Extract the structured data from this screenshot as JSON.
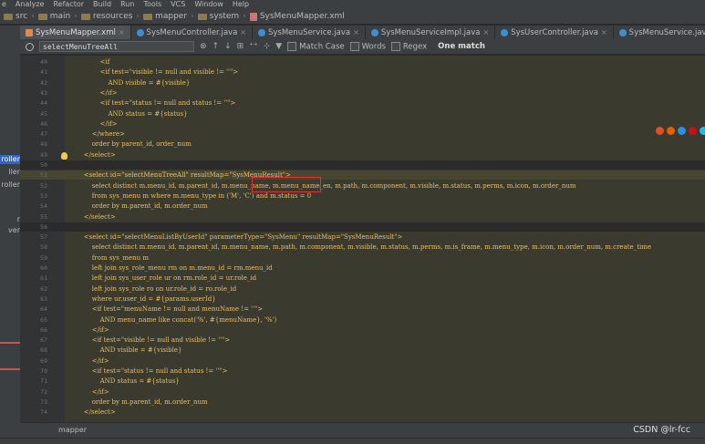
{
  "menubar": {
    "items": [
      "e",
      "Analyze",
      "Refactor",
      "Build",
      "Run",
      "Tools",
      "VCS",
      "Window",
      "Help"
    ]
  },
  "breadcrumbs": [
    "src",
    "main",
    "resources",
    "mapper",
    "system",
    "SysMenuMapper.xml"
  ],
  "tabs": [
    {
      "label": "SysMenuMapper.xml",
      "active": true,
      "icon": "xml-file-icon"
    },
    {
      "label": "SysMenuController.java",
      "active": false,
      "icon": "java-class-icon"
    },
    {
      "label": "SysMenuService.java",
      "active": false,
      "icon": "java-class-icon"
    },
    {
      "label": "SysMenuServiceImpl.java",
      "active": false,
      "icon": "java-class-icon"
    },
    {
      "label": "SysUserController.java",
      "active": false,
      "icon": "java-class-icon"
    },
    {
      "label": "SysMenuService.java",
      "active": false,
      "icon": "java-class-icon"
    }
  ],
  "sidebar": {
    "items": [
      "roller",
      "ller",
      "roller",
      "r",
      "ver"
    ]
  },
  "search": {
    "value": "selectMenuTreeAll",
    "match_case_label": "Match Case",
    "words_label": "Words",
    "regex_label": "Regex",
    "result_label": "One match"
  },
  "code": {
    "lines": [
      {
        "n": "40",
        "t": "                <if"
      },
      {
        "n": "41",
        "t": "                <if test=\"visible != null and visible != ''\">"
      },
      {
        "n": "42",
        "t": "                    AND visible = #{visible}"
      },
      {
        "n": "43",
        "t": "                </if>"
      },
      {
        "n": "44",
        "t": "                <if test=\"status != null and status != ''\">"
      },
      {
        "n": "45",
        "t": "                    AND status = #{status}"
      },
      {
        "n": "46",
        "t": "                </if>"
      },
      {
        "n": "47",
        "t": "            </where>"
      },
      {
        "n": "48",
        "t": "            order by parent_id, order_num"
      },
      {
        "n": "49",
        "t": "        </select>"
      },
      {
        "n": "50",
        "t": ""
      },
      {
        "n": "51",
        "t": "        <select id=\"selectMenuTreeAll\" resultMap=\"SysMenuResult\">"
      },
      {
        "n": "52",
        "t": "            select distinct m.menu_id, m.parent_id, m.menu_name, m.menu_name_en, m.path, m.component, m.visible, m.status, m.perms, m.icon, m.order_num"
      },
      {
        "n": "53",
        "t": "            from sys_menu m where m.menu_type in ('M', 'C') and m.status = 0"
      },
      {
        "n": "54",
        "t": "            order by m.parent_id, m.order_num"
      },
      {
        "n": "55",
        "t": "        </select>"
      },
      {
        "n": "56",
        "t": ""
      },
      {
        "n": "57",
        "t": "        <select id=\"selectMenuListByUserId\" parameterType=\"SysMenu\" resultMap=\"SysMenuResult\">"
      },
      {
        "n": "58",
        "t": "            select distinct m.menu_id, m.parent_id, m.menu_name, m.path, m.component, m.visible, m.status, m.perms, m.is_frame, m.menu_type, m.icon, m.order_num, m.create_time"
      },
      {
        "n": "59",
        "t": "            from sys_menu m"
      },
      {
        "n": "60",
        "t": "            left join sys_role_menu rm on m.menu_id = rm.menu_id"
      },
      {
        "n": "61",
        "t": "            left join sys_user_role ur on rm.role_id = ur.role_id"
      },
      {
        "n": "62",
        "t": "            left join sys_role ro on ur.role_id = ro.role_id"
      },
      {
        "n": "63",
        "t": "            where ur.user_id = #{params.userId}"
      },
      {
        "n": "64",
        "t": "            <if test=\"menuName != null and menuName != ''\">"
      },
      {
        "n": "65",
        "t": "                AND menu_name like concat('%', #{menuName}, '%')"
      },
      {
        "n": "66",
        "t": "            </if>"
      },
      {
        "n": "67",
        "t": "            <if test=\"visible != null and visible != ''\">"
      },
      {
        "n": "68",
        "t": "                AND visible = #{visible}"
      },
      {
        "n": "69",
        "t": "            </if>"
      },
      {
        "n": "70",
        "t": "            <if test=\"status != null and status != ''\">"
      },
      {
        "n": "71",
        "t": "                AND status = #{status}"
      },
      {
        "n": "72",
        "t": "            </if>"
      },
      {
        "n": "73",
        "t": "            order by m.parent_id, m.order_num"
      },
      {
        "n": "74",
        "t": "        </select>"
      }
    ]
  },
  "statusbar": {
    "text": "mapper"
  },
  "watermark": "CSDN @lr-fcc",
  "colors": {
    "editor_bg": "#3b3a2e",
    "xml_tag": "#e8bf6a",
    "keyword": "#cc7832",
    "highlight_box": "#e0302f",
    "selection": "#2f65ca"
  }
}
